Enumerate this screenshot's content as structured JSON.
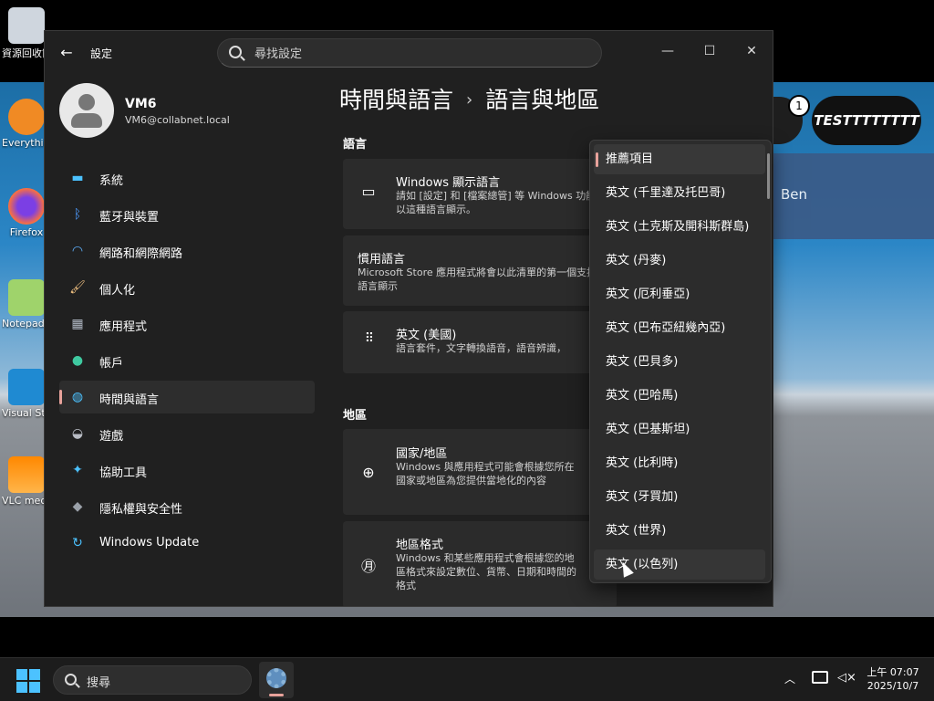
{
  "desktop": {
    "icons": [
      {
        "label": "資源回收筒",
        "name": "recycle-bin"
      },
      {
        "label": "Everything",
        "name": "everything"
      },
      {
        "label": "Firefox",
        "name": "firefox"
      },
      {
        "label": "Notepad++",
        "name": "notepad"
      },
      {
        "label": "Visual Studio Code",
        "name": "vscode"
      },
      {
        "label": "VLC media player",
        "name": "vlc"
      }
    ],
    "bubble_count": "1",
    "test_label": "TESTTTTTTTT",
    "ben_label": "Ben"
  },
  "window": {
    "title": "設定",
    "search_placeholder": "尋找設定",
    "controls": {
      "minimize": "—",
      "maximize": "☐",
      "close": "✕"
    }
  },
  "profile": {
    "name": "VM6",
    "email": "VM6@collabnet.local"
  },
  "nav": [
    {
      "label": "系統",
      "icon": "monitor-icon",
      "glyph": "▬",
      "color": "#4cc2ff"
    },
    {
      "label": "藍牙與裝置",
      "icon": "bluetooth-icon",
      "glyph": "ᛒ",
      "color": "#4c9bff"
    },
    {
      "label": "網路和網際網路",
      "icon": "wifi-icon",
      "glyph": "◠",
      "color": "#5fb2ff"
    },
    {
      "label": "個人化",
      "icon": "brush-icon",
      "glyph": "🖌",
      "color": "#f0c080"
    },
    {
      "label": "應用程式",
      "icon": "apps-icon",
      "glyph": "▦",
      "color": "#b0b8c4"
    },
    {
      "label": "帳戶",
      "icon": "account-icon",
      "glyph": "●",
      "color": "#3fc9a0"
    },
    {
      "label": "時間與語言",
      "icon": "globe-clock-icon",
      "glyph": "◍",
      "color": "#4cc2ff"
    },
    {
      "label": "遊戲",
      "icon": "gamepad-icon",
      "glyph": "◒",
      "color": "#b8bcc4"
    },
    {
      "label": "協助工具",
      "icon": "accessibility-icon",
      "glyph": "✦",
      "color": "#4cc2ff"
    },
    {
      "label": "隱私權與安全性",
      "icon": "shield-icon",
      "glyph": "◆",
      "color": "#9aa0a8"
    },
    {
      "label": "Windows Update",
      "icon": "update-icon",
      "glyph": "↻",
      "color": "#4cc2ff"
    }
  ],
  "selected_nav": 6,
  "breadcrumb": {
    "parent": "時間與語言",
    "separator": "›",
    "current": "語言與地區"
  },
  "language_section": {
    "title": "語言",
    "display_language": {
      "title": "Windows 顯示語言",
      "desc": "請如 [設定] 和 [檔案總管] 等 Windows 功能會以這種語言顯示。"
    },
    "preferred": {
      "title": "慣用語言",
      "desc": "Microsoft Store 應用程式將會以此清單的第一個支援語言顯示"
    },
    "english_us": {
      "title": "英文 (美國)",
      "desc": "語言套件，文字轉換語音，語音辨識，"
    }
  },
  "region_section": {
    "title": "地區",
    "country": {
      "title": "國家/地區",
      "desc": "Windows 與應用程式可能會根據您所在國家或地區為您提供當地化的內容"
    },
    "format": {
      "title": "地區格式",
      "desc": "Windows 和某些應用程式會根據您的地區格式來設定數位、貨幣、日期和時間的格式"
    }
  },
  "dropdown": {
    "items": [
      "推薦項目",
      "英文 (千里達及托巴哥)",
      "英文 (土克斯及開科斯群島)",
      "英文 (丹麥)",
      "英文 (厄利垂亞)",
      "英文 (巴布亞紐幾內亞)",
      "英文 (巴貝多)",
      "英文 (巴哈馬)",
      "英文 (巴基斯坦)",
      "英文 (比利時)",
      "英文 (牙買加)",
      "英文 (世界)",
      "英文 (以色列)"
    ],
    "selected_index": 0,
    "hover_index": 12
  },
  "taskbar": {
    "search_label": "搜尋",
    "time": "上午 07:07",
    "date": "2025/10/7"
  }
}
